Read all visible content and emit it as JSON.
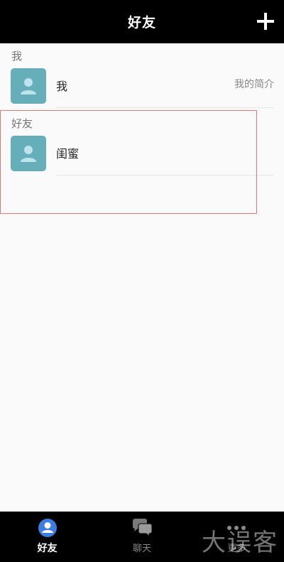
{
  "header": {
    "title": "好友"
  },
  "sections": {
    "me": {
      "header": "我",
      "row": {
        "name": "我",
        "right_text": "我的简介"
      }
    },
    "friends": {
      "header": "好友",
      "row": {
        "name": "闺蜜"
      }
    }
  },
  "bottom_nav": {
    "items": [
      {
        "label": "好友",
        "active": true
      },
      {
        "label": "聊天",
        "active": false
      },
      {
        "label": "更多",
        "active": false
      }
    ]
  },
  "watermark": {
    "text": "大误客"
  },
  "colors": {
    "topbar_bg": "#000000",
    "avatar_bg": "#66aeba",
    "active_tab_icon": "#3b7de0",
    "highlight_border": "#e07a7a"
  },
  "icons": {
    "add": "plus-icon",
    "avatar": "person-icon",
    "friends_tab": "person-circle-icon",
    "chat_tab": "chat-bubbles-icon",
    "more_tab": "more-dots-icon"
  }
}
